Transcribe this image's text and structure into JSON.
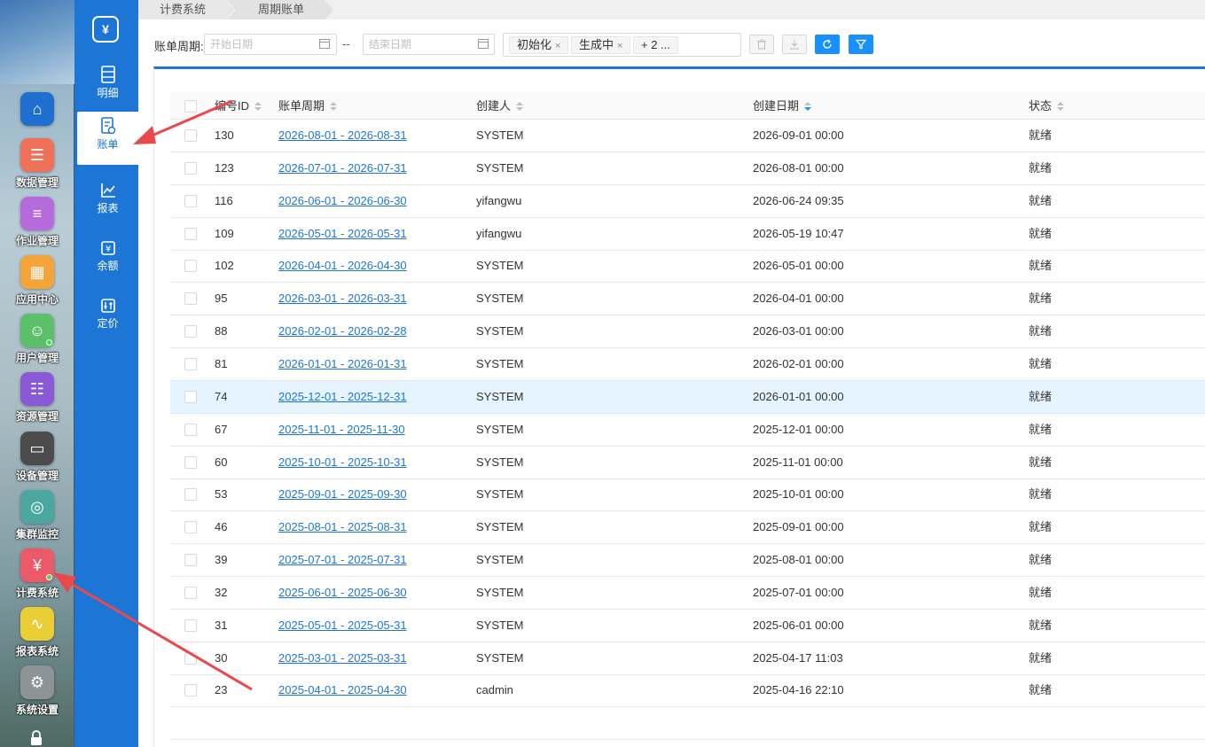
{
  "dock": {
    "items": [
      {
        "label": "",
        "icon": "home-icon",
        "color": "#1e6fd0"
      },
      {
        "label": "数据管理",
        "icon": "data-manage-icon",
        "color": "#f0715a"
      },
      {
        "label": "作业管理",
        "icon": "job-manage-icon",
        "color": "#b56bdc"
      },
      {
        "label": "应用中心",
        "icon": "app-center-icon",
        "color": "#f4a53a"
      },
      {
        "label": "用户管理",
        "icon": "user-manage-icon",
        "color": "#5cc06a"
      },
      {
        "label": "资源管理",
        "icon": "resource-manage-icon",
        "color": "#8a5ad6"
      },
      {
        "label": "设备管理",
        "icon": "device-manage-icon",
        "color": "#4c4c4c"
      },
      {
        "label": "集群监控",
        "icon": "cluster-monitor-icon",
        "color": "#4aa8a0"
      },
      {
        "label": "计费系统",
        "icon": "billing-system-icon",
        "color": "#ec5a6a"
      },
      {
        "label": "报表系统",
        "icon": "report-system-icon",
        "color": "#e9cf35"
      },
      {
        "label": "系统设置",
        "icon": "system-settings-icon",
        "color": "#8d9496"
      }
    ]
  },
  "subnav": {
    "logo_text": "¥",
    "items": [
      {
        "label": "明细",
        "icon": "detail-icon"
      },
      {
        "label": "账单",
        "icon": "bill-icon"
      },
      {
        "label": "报表",
        "icon": "chart-icon"
      },
      {
        "label": "余额",
        "icon": "balance-icon"
      },
      {
        "label": "定价",
        "icon": "pricing-icon"
      }
    ]
  },
  "breadcrumb": {
    "items": [
      "计费系统",
      "周期账单"
    ]
  },
  "filters": {
    "period_label": "账单周期:",
    "start_placeholder": "开始日期",
    "end_placeholder": "结束日期",
    "separator": "--",
    "status_tags": [
      "初始化",
      "生成中",
      "+ 2 ..."
    ],
    "tag_close": "×"
  },
  "table": {
    "columns": [
      "编号ID",
      "账单周期",
      "创建人",
      "创建日期",
      "状态"
    ],
    "rows": [
      {
        "id": "130",
        "period": "2026-08-01 - 2026-08-31",
        "creator": "SYSTEM",
        "created": "2026-09-01 00:00",
        "status": "就绪"
      },
      {
        "id": "123",
        "period": "2026-07-01 - 2026-07-31",
        "creator": "SYSTEM",
        "created": "2026-08-01 00:00",
        "status": "就绪"
      },
      {
        "id": "116",
        "period": "2026-06-01 - 2026-06-30",
        "creator": "yifangwu",
        "created": "2026-06-24 09:35",
        "status": "就绪"
      },
      {
        "id": "109",
        "period": "2026-05-01 - 2026-05-31",
        "creator": "yifangwu",
        "created": "2026-05-19 10:47",
        "status": "就绪"
      },
      {
        "id": "102",
        "period": "2026-04-01 - 2026-04-30",
        "creator": "SYSTEM",
        "created": "2026-05-01 00:00",
        "status": "就绪"
      },
      {
        "id": "95",
        "period": "2026-03-01 - 2026-03-31",
        "creator": "SYSTEM",
        "created": "2026-04-01 00:00",
        "status": "就绪"
      },
      {
        "id": "88",
        "period": "2026-02-01 - 2026-02-28",
        "creator": "SYSTEM",
        "created": "2026-03-01 00:00",
        "status": "就绪"
      },
      {
        "id": "81",
        "period": "2026-01-01 - 2026-01-31",
        "creator": "SYSTEM",
        "created": "2026-02-01 00:00",
        "status": "就绪"
      },
      {
        "id": "74",
        "period": "2025-12-01 - 2025-12-31",
        "creator": "SYSTEM",
        "created": "2026-01-01 00:00",
        "status": "就绪"
      },
      {
        "id": "67",
        "period": "2025-11-01 - 2025-11-30",
        "creator": "SYSTEM",
        "created": "2025-12-01 00:00",
        "status": "就绪"
      },
      {
        "id": "60",
        "period": "2025-10-01 - 2025-10-31",
        "creator": "SYSTEM",
        "created": "2025-11-01 00:00",
        "status": "就绪"
      },
      {
        "id": "53",
        "period": "2025-09-01 - 2025-09-30",
        "creator": "SYSTEM",
        "created": "2025-10-01 00:00",
        "status": "就绪"
      },
      {
        "id": "46",
        "period": "2025-08-01 - 2025-08-31",
        "creator": "SYSTEM",
        "created": "2025-09-01 00:00",
        "status": "就绪"
      },
      {
        "id": "39",
        "period": "2025-07-01 - 2025-07-31",
        "creator": "SYSTEM",
        "created": "2025-08-01 00:00",
        "status": "就绪"
      },
      {
        "id": "32",
        "period": "2025-06-01 - 2025-06-30",
        "creator": "SYSTEM",
        "created": "2025-07-01 00:00",
        "status": "就绪"
      },
      {
        "id": "31",
        "period": "2025-05-01 - 2025-05-31",
        "creator": "SYSTEM",
        "created": "2025-06-01 00:00",
        "status": "就绪"
      },
      {
        "id": "30",
        "period": "2025-03-01 - 2025-03-31",
        "creator": "SYSTEM",
        "created": "2025-04-17 11:03",
        "status": "就绪"
      },
      {
        "id": "23",
        "period": "2025-04-01 - 2025-04-30",
        "creator": "cadmin",
        "created": "2025-04-16 22:10",
        "status": "就绪"
      }
    ]
  },
  "colors": {
    "primary": "#1d76d6",
    "accent": "#1890ff",
    "annotation": "#e8494b",
    "hover_row": "#e6f4ff"
  }
}
